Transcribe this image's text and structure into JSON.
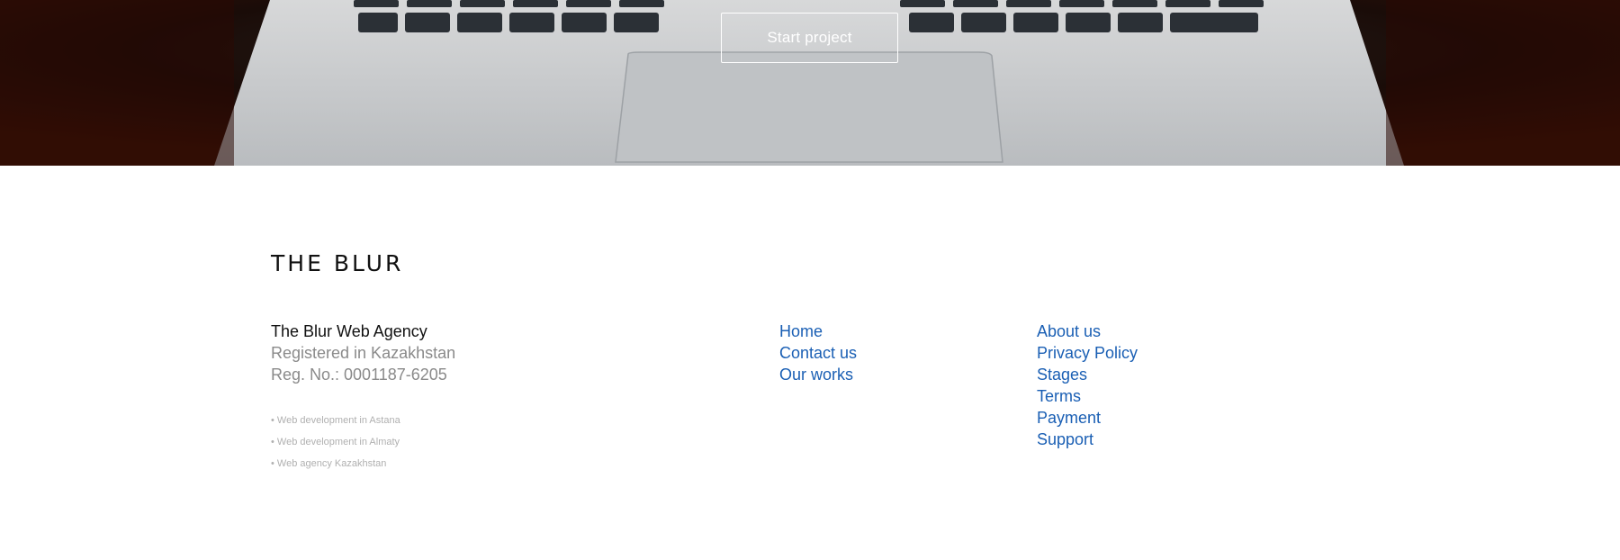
{
  "hero": {
    "cta_label": "Start project"
  },
  "footer": {
    "brand": "THE BLUR",
    "company": {
      "name": "The Blur Web Agency",
      "registered": "Registered in Kazakhstan",
      "reg_no": "Reg. No.: 0001187-6205"
    },
    "services": [
      "• Web development in Astana",
      "• Web development in Almaty",
      "• Web agency Kazakhstan"
    ],
    "nav_primary": [
      "Home",
      "Contact us",
      "Our works"
    ],
    "nav_secondary": [
      "About us",
      "Privacy Policy",
      "Stages",
      "Terms",
      "Payment",
      "Support"
    ]
  },
  "colors": {
    "link": "#1a5fb4",
    "text_dark": "#111111",
    "text_muted": "#8a8a8a",
    "text_faint": "#b0b0b0"
  },
  "icons": {
    "hero_background": "laptop-photo"
  }
}
